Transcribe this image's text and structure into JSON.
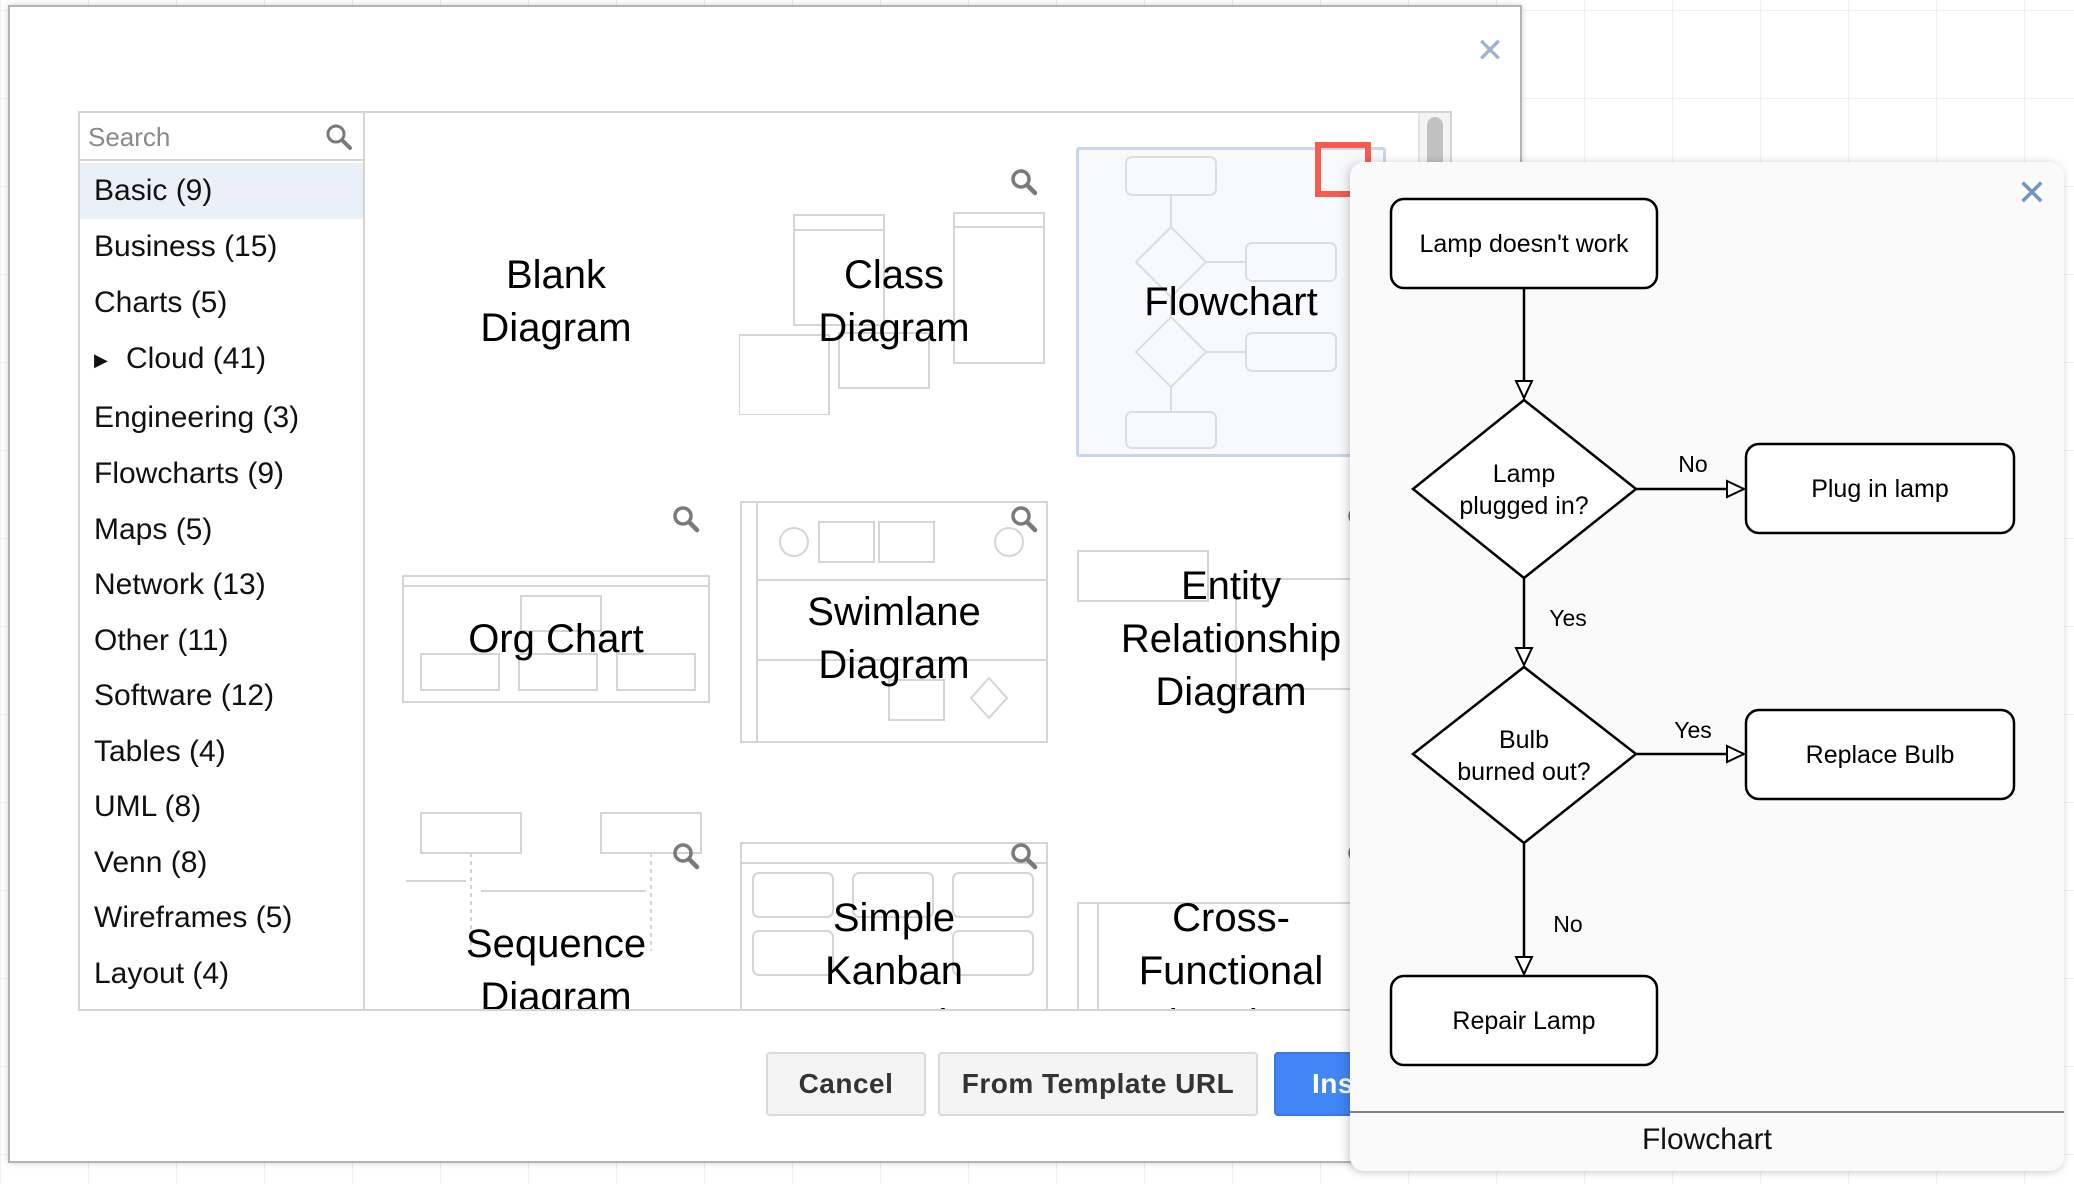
{
  "dialog": {
    "close_icon": "close-icon",
    "search": {
      "placeholder": "Search",
      "value": "",
      "icon": "search-icon"
    },
    "categories": [
      {
        "label": "Basic (9)",
        "selected": true
      },
      {
        "label": "Business (15)"
      },
      {
        "label": "Charts (5)"
      },
      {
        "label": "Cloud (41)",
        "expandable": true,
        "icon": "triangle-right-icon"
      },
      {
        "label": "Engineering (3)"
      },
      {
        "label": "Flowcharts (9)"
      },
      {
        "label": "Maps (5)"
      },
      {
        "label": "Network (13)"
      },
      {
        "label": "Other (11)"
      },
      {
        "label": "Software (12)"
      },
      {
        "label": "Tables (4)"
      },
      {
        "label": "UML (8)"
      },
      {
        "label": "Venn (8)"
      },
      {
        "label": "Wireframes (5)"
      },
      {
        "label": "Layout (4)"
      }
    ],
    "templates": [
      {
        "lines": [
          "Blank",
          "Diagram"
        ]
      },
      {
        "lines": [
          "Class",
          "Diagram"
        ]
      },
      {
        "lines": [
          "Flowchart"
        ],
        "selected": true
      },
      {
        "lines": [
          "Org Chart"
        ]
      },
      {
        "lines": [
          "Swimlane",
          "Diagram"
        ]
      },
      {
        "lines": [
          "Entity",
          "Relationship",
          "Diagram"
        ]
      },
      {
        "lines": [
          "Sequence",
          "Diagram"
        ]
      },
      {
        "lines": [
          "Simple",
          "Kanban",
          "Board"
        ]
      },
      {
        "lines": [
          "Cross-",
          "Functional",
          "Flowchart"
        ]
      }
    ],
    "buttons": {
      "cancel": "Cancel",
      "from_url": "From Template URL",
      "insert": "Insert"
    }
  },
  "preview": {
    "title": "Flowchart",
    "close_icon": "close-icon",
    "nodes": {
      "start": "Lamp doesn't work",
      "decision1": [
        "Lamp",
        "plugged in?"
      ],
      "plug": "Plug in lamp",
      "decision2": [
        "Bulb",
        "burned out?"
      ],
      "replace": "Replace Bulb",
      "repair": "Repair Lamp"
    },
    "edges": {
      "d1_no": "No",
      "d1_yes": "Yes",
      "d2_yes": "Yes",
      "d2_no": "No"
    }
  },
  "colors": {
    "primary": "#4285f4",
    "selection": "#e9f0f8",
    "highlight": "#f55b4f",
    "close": "#6f95c6"
  }
}
